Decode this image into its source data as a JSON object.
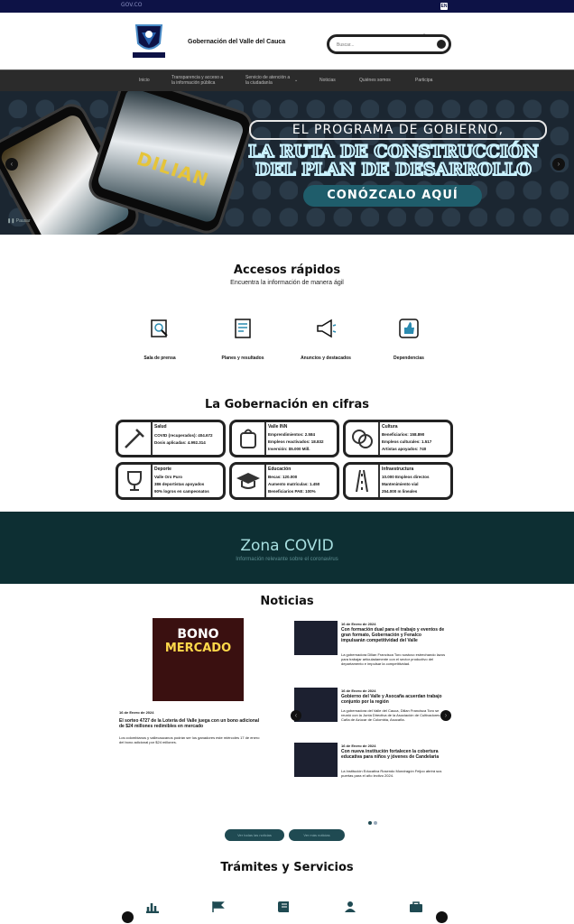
{
  "topbar": {
    "gov_label": "GOV.CO",
    "lang": "EN"
  },
  "header": {
    "brand": "Gobernación del Valle del Cauca",
    "search_placeholder": "Buscar...",
    "search_label": "Buscar"
  },
  "nav": {
    "items": [
      {
        "label": "Inicio"
      },
      {
        "label": "Transparencia y acceso a la información pública"
      },
      {
        "label": "Servicio de atención a la ciudadanía"
      },
      {
        "label": "Noticias"
      },
      {
        "label": "Quiénes somos"
      },
      {
        "label": "Participa"
      }
    ]
  },
  "hero": {
    "line1": "EL PROGRAMA DE GOBIERNO,",
    "line2": "LA RUTA DE CONSTRUCCIÓN",
    "line3": "DEL PLAN DE DESARROLLO",
    "cta": "CONÓZCALO AQUÍ",
    "phone_text": "DILIAN",
    "pause": "❚❚ Pausar"
  },
  "quick_access": {
    "title": "Accesos rápidos",
    "subtitle": "Encuentra la información de manera ágil",
    "items": [
      {
        "label": "Sala de prensa",
        "icon": "press-icon"
      },
      {
        "label": "Planes y resultados",
        "icon": "document-icon"
      },
      {
        "label": "Anuncios y destacados",
        "icon": "megaphone-icon"
      },
      {
        "label": "Dependencias",
        "icon": "thumbs-up-icon"
      }
    ]
  },
  "figures": {
    "title": "La Gobernación en cifras",
    "cards": [
      {
        "title": "Salud",
        "lines": [
          "COVID (recuperados): 404.672",
          "Dosis aplicadas: 4.992.314"
        ],
        "icon": "syringe-icon"
      },
      {
        "title": "Valle INN",
        "lines": [
          "Emprendimientos: 2.584",
          "Empleos reactivados: 18.832",
          "Inversión: $5.000 Mill."
        ],
        "icon": "bag-icon"
      },
      {
        "title": "Cultura",
        "lines": [
          "Beneficiarios: 158.890",
          "Empleos culturales: 1.517",
          "Artistas apoyados: 740"
        ],
        "icon": "masks-icon"
      },
      {
        "title": "Deporte",
        "lines": [
          "Valle Oro Puro",
          "386 deportistas apoyados",
          "90% logros en campeonatos"
        ],
        "icon": "trophy-icon"
      },
      {
        "title": "Educación",
        "lines": [
          "Becas: 120.000",
          "Aumento matrículas: 1.450",
          "Beneficiarios PAE: 100%"
        ],
        "icon": "graduation-cap-icon"
      },
      {
        "title": "Infraestructura",
        "lines": [
          "10.000 Empleos directos",
          "Mantenimiento vial",
          "254.000 m lineales"
        ],
        "icon": "road-icon"
      }
    ]
  },
  "covid": {
    "title": "Zona COVID",
    "subtitle": "Información relevante sobre el coronavirus"
  },
  "news": {
    "title": "Noticias",
    "main": {
      "image_text_1": "BONO",
      "image_text_2": "MERCADO",
      "date": "16 de Enero de 2024",
      "title": "El sorteo 4727 de la Lotería del Valle juega con un bono adicional de $24 millones redimibles en mercado",
      "text": "Los colombianos y vallecaucanos podrán ser los ganadores este miércoles 17 de enero del bono adicional por $24 millones."
    },
    "items": [
      {
        "date": "16 de Enero de 2024",
        "title": "Con formación dual para el trabajo y eventos de gran formato, Gobernación y Fenalco impulsarán competitividad del Valle",
        "text": "La gobernadora Dilian Francisca Toro sostuvo estrechando lazos para trabajar articuladamente con el sector productivo del departamento e impulsar la competitividad."
      },
      {
        "date": "16 de Enero de 2024",
        "title": "Gobierno del Valle y Asocaña acuerdan trabajo conjunto por la región",
        "text": "La gobernadora del Valle del Cauca, Dilian Francisca Toro se reunió con la Junta Directiva de la Asociación de Cultivadores de Caña de Azúcar de Colombia, Asocaña."
      },
      {
        "date": "16 de Enero de 2024",
        "title": "Con nueva institución fortalecen la cobertura educativa para niños y jóvenes de Candelaria",
        "text": "La Institución Educativa Rosendo Mondragón Feijoo abrirá sus puertas para el año lectivo 2024."
      }
    ],
    "btn_all": "Ver todas las noticias",
    "btn_more": "Ver más noticias"
  },
  "services": {
    "title": "Trámites y Servicios",
    "icons": [
      "chart-icon",
      "flag-icon",
      "book-icon",
      "person-icon",
      "briefcase-icon"
    ]
  }
}
